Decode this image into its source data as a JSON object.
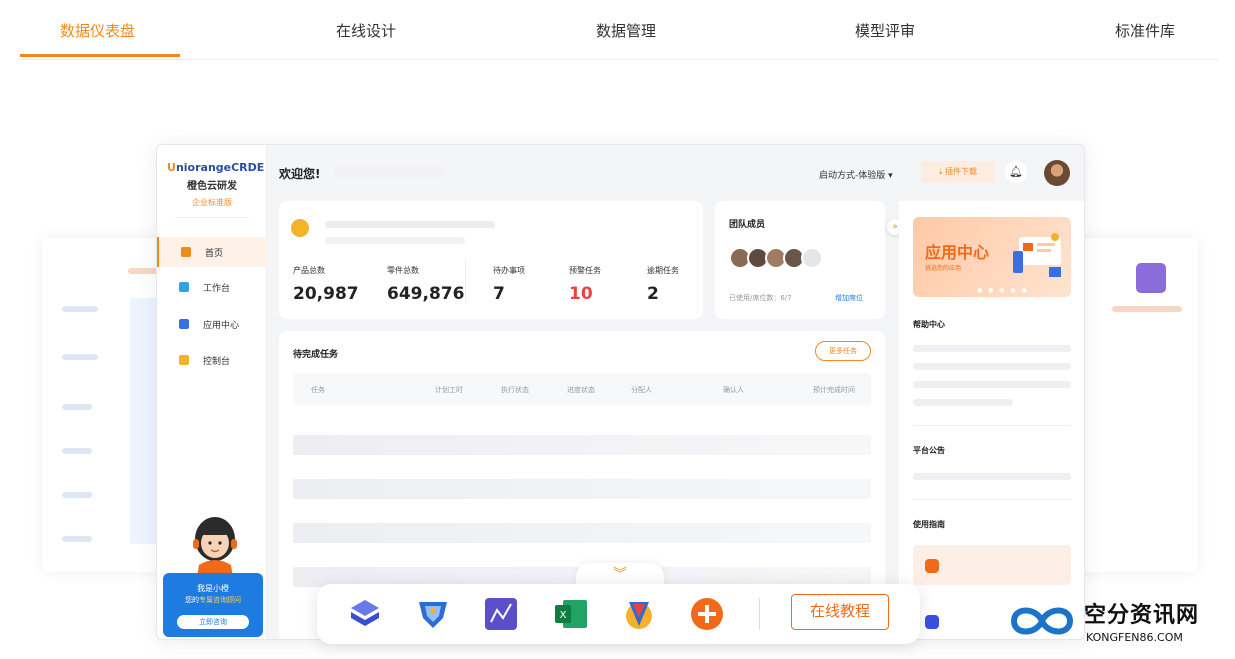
{
  "topnav": {
    "tabs": [
      {
        "label": "数据仪表盘",
        "active": true
      },
      {
        "label": "在线设计",
        "active": false
      },
      {
        "label": "数据管理",
        "active": false
      },
      {
        "label": "模型评审",
        "active": false
      },
      {
        "label": "标准件库",
        "active": false
      }
    ]
  },
  "app": {
    "logo": {
      "brand_u": "U",
      "brand_rest": "niorangeCRDE",
      "cn_name": "橙色云研发",
      "edition": "企业标准版"
    },
    "sidebar": {
      "items": [
        {
          "label": "首页",
          "icon": "home-icon",
          "active": true
        },
        {
          "label": "工作台",
          "icon": "workbench-icon",
          "active": false
        },
        {
          "label": "应用中心",
          "icon": "apps-grid-icon",
          "active": false
        },
        {
          "label": "控制台",
          "icon": "console-icon",
          "active": false
        }
      ],
      "helper": {
        "line1": "我是小橙",
        "line2_prefix": "您的",
        "line2_highlight": "专属咨询顾问",
        "button": "立即咨询"
      }
    },
    "header": {
      "welcome": "欢迎您!",
      "mode": "启动方式-体验版 ▾",
      "plugin_download": "插件下载"
    },
    "stats": [
      {
        "label": "产品总数",
        "value": "20,987",
        "alert": false
      },
      {
        "label": "零件总数",
        "value": "649,876",
        "alert": false
      },
      {
        "label": "待办事项",
        "value": "7",
        "alert": false
      },
      {
        "label": "预警任务",
        "value": "10",
        "alert": true
      },
      {
        "label": "逾期任务",
        "value": "2",
        "alert": false
      }
    ],
    "team": {
      "title": "团队成员",
      "usage": "已使用/席位数：6/7",
      "add_seat": "增加席位"
    },
    "tasks": {
      "title": "待完成任务",
      "more": "更多任务",
      "columns": [
        "任务",
        "计划工时",
        "执行状态",
        "进度状态",
        "分配人",
        "确认人",
        "预计完成时间"
      ]
    },
    "right_panel": {
      "banner_title": "应用中心",
      "banner_sub": "挑选您的应用",
      "help_center": "帮助中心",
      "announcements": "平台公告",
      "guide": "使用指南"
    }
  },
  "dock": {
    "apps": [
      "3d-design-app",
      "simulation-app",
      "pcb-app",
      "excel-app",
      "model-review-app",
      "add-app"
    ],
    "tutorial": "在线教程"
  },
  "watermark": {
    "title": "空分资讯网",
    "sub": "KONGFEN86.COM"
  },
  "colors": {
    "accent": "#f18a1e",
    "alert": "#e84242",
    "link": "#1e7be0"
  }
}
